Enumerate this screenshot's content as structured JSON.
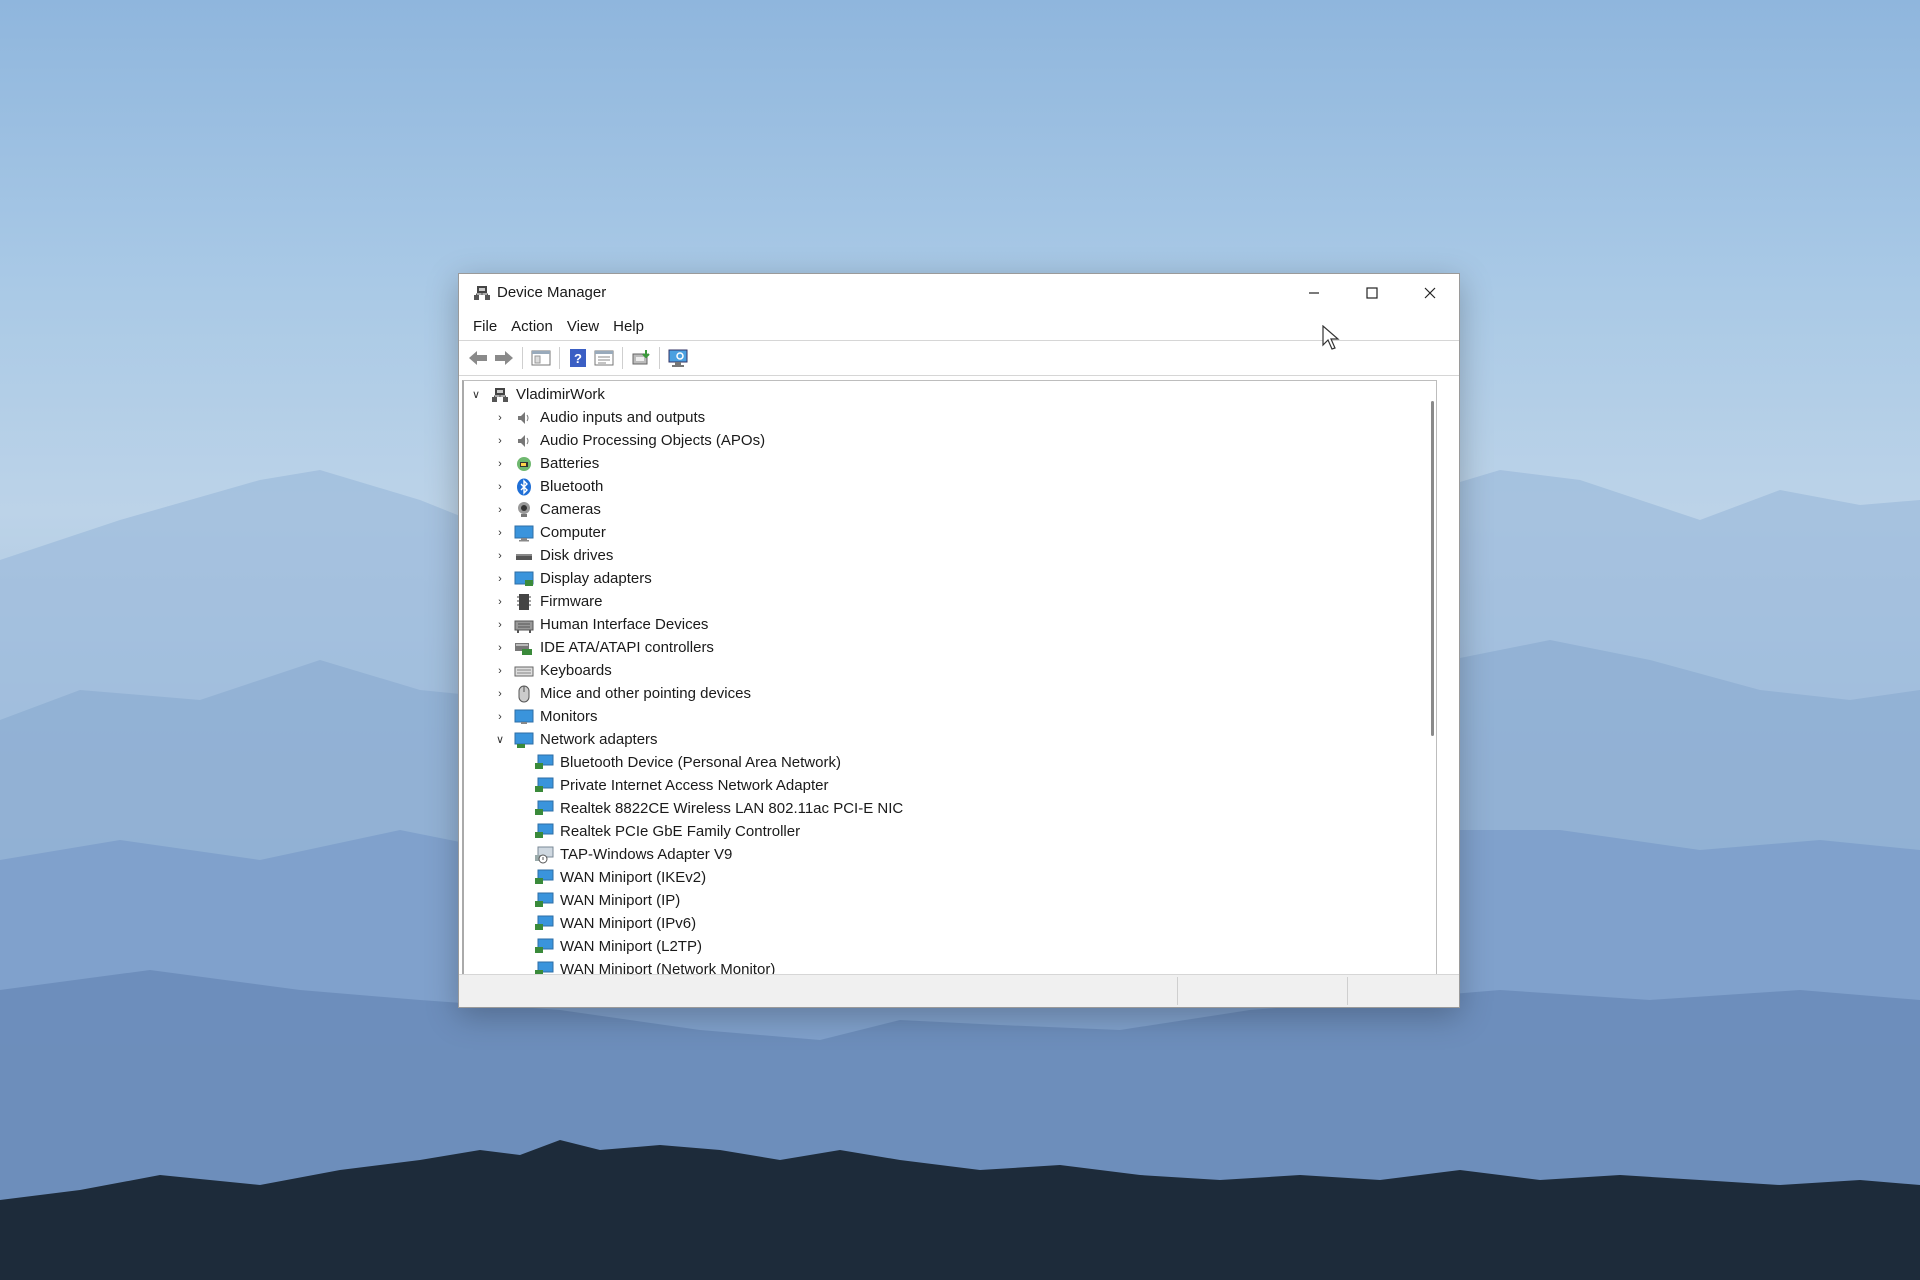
{
  "window": {
    "title": "Device Manager"
  },
  "menu": [
    "File",
    "Action",
    "View",
    "Help"
  ],
  "toolbar": {
    "buttons": [
      "back-icon",
      "forward-icon",
      "show-hide-console-tree-icon",
      "help-icon",
      "properties-icon",
      "update-driver-icon",
      "scan-hardware-icon"
    ]
  },
  "tree": {
    "root": "VladimirWork",
    "categories": [
      "Audio inputs and outputs",
      "Audio Processing Objects (APOs)",
      "Batteries",
      "Bluetooth",
      "Cameras",
      "Computer",
      "Disk drives",
      "Display adapters",
      "Firmware",
      "Human Interface Devices",
      "IDE ATA/ATAPI controllers",
      "Keyboards",
      "Mice and other pointing devices",
      "Monitors"
    ],
    "expanded_category": "Network adapters",
    "network_devices": [
      "Bluetooth Device (Personal Area Network)",
      "Private Internet Access Network Adapter",
      "Realtek 8822CE Wireless LAN 802.11ac PCI-E NIC",
      "Realtek PCIe GbE Family Controller",
      "TAP-Windows Adapter V9",
      "WAN Miniport (IKEv2)",
      "WAN Miniport (IP)",
      "WAN Miniport (IPv6)",
      "WAN Miniport (L2TP)",
      "WAN Miniport (Network Monitor)"
    ]
  }
}
